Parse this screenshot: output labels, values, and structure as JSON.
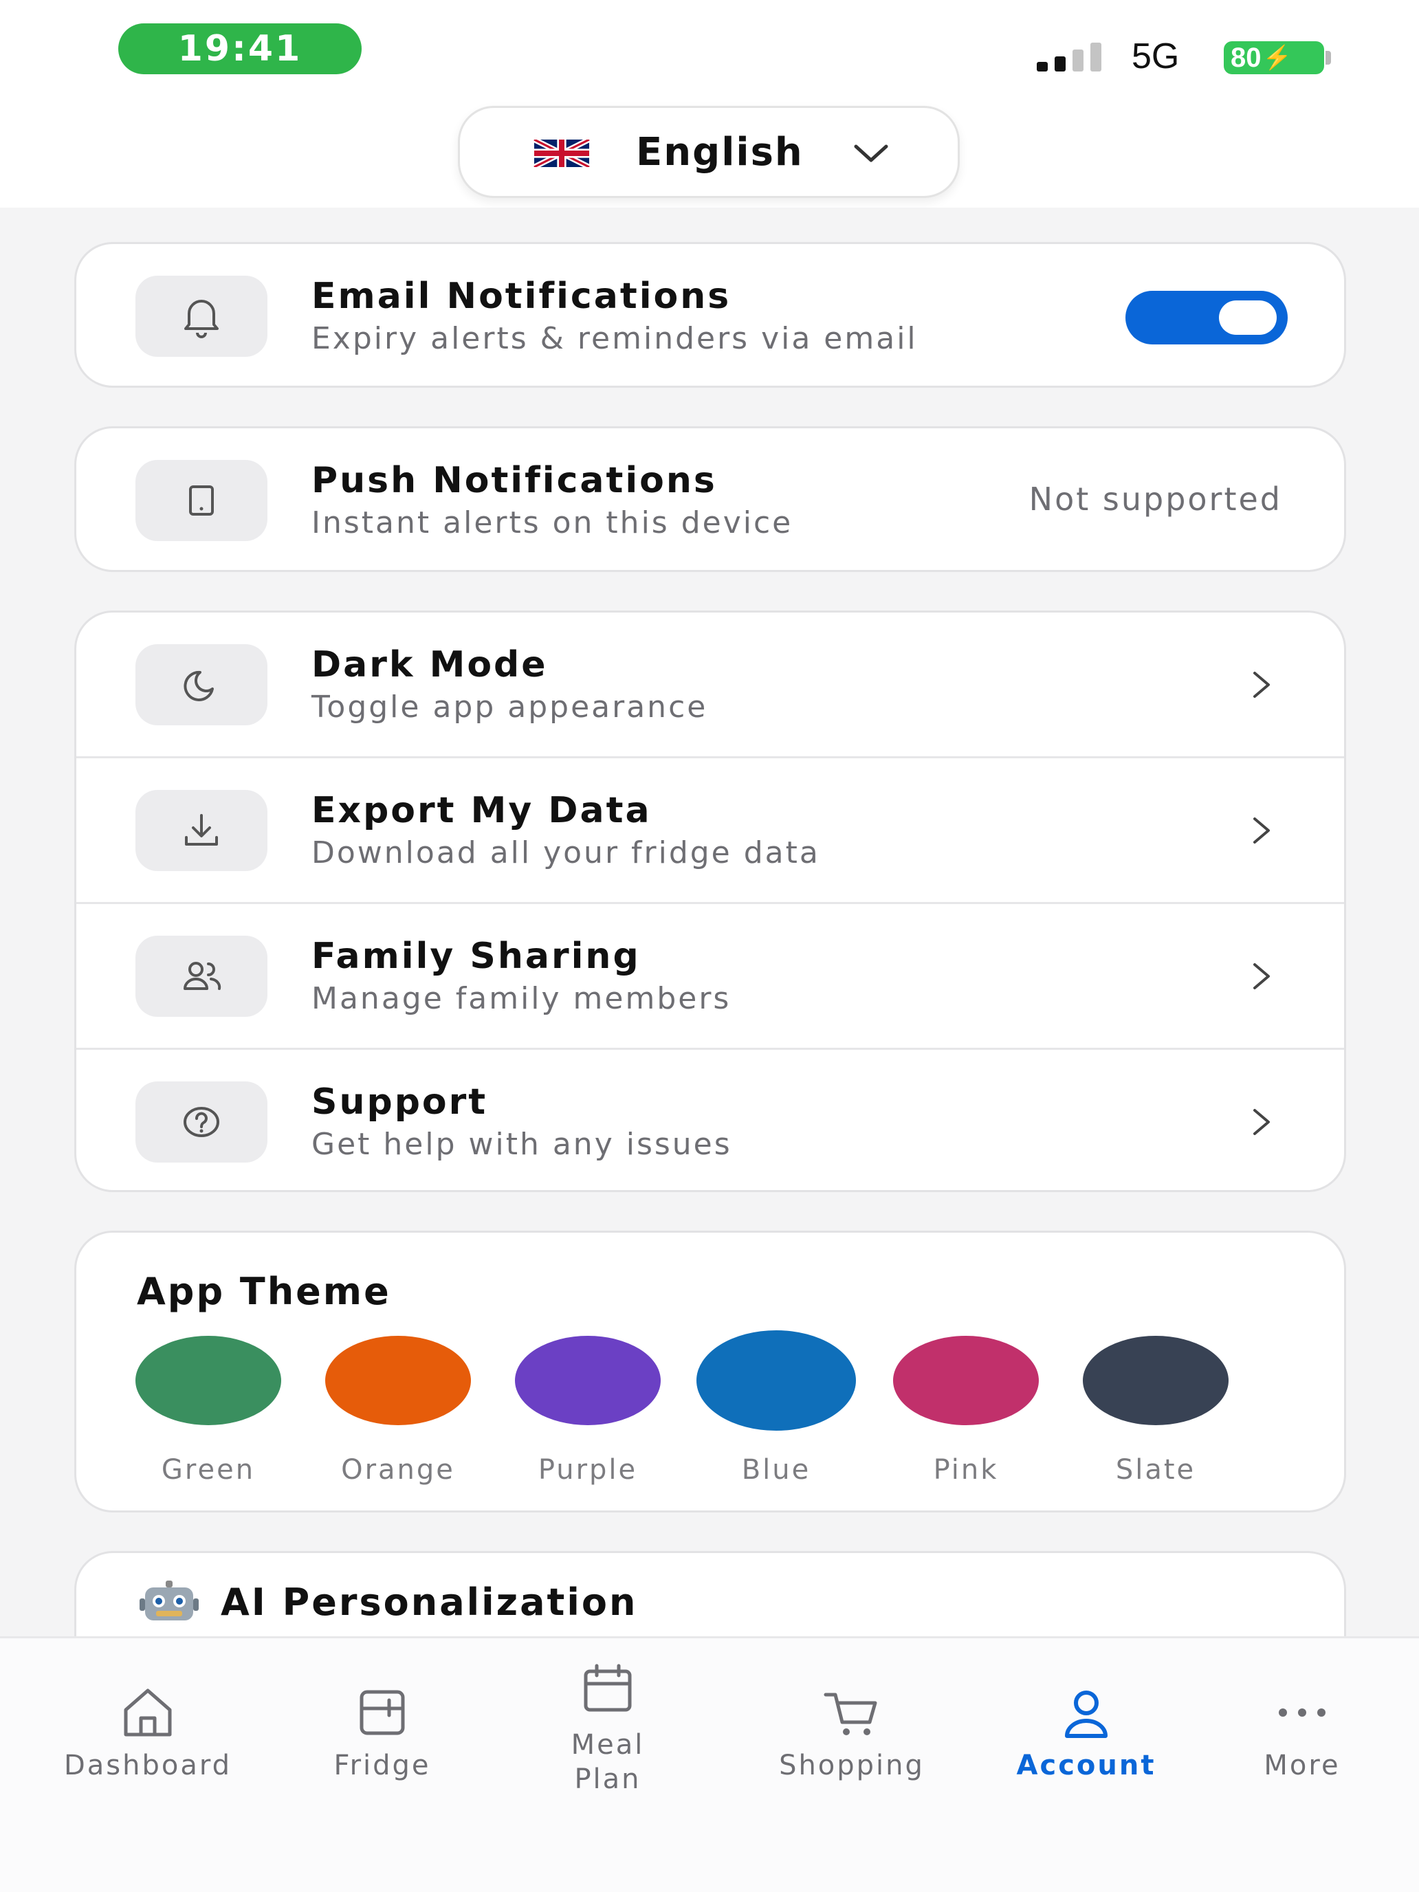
{
  "status_bar": {
    "time": "19:41",
    "network": "5G",
    "battery": "80"
  },
  "language": {
    "label": "English",
    "flag": "uk-flag-icon"
  },
  "notifications": {
    "email": {
      "title": "Email Notifications",
      "subtitle": "Expiry alerts & reminders via email",
      "enabled": true,
      "icon": "bell-icon"
    },
    "push": {
      "title": "Push Notifications",
      "subtitle": "Instant alerts on this device",
      "status": "Not supported",
      "icon": "tablet-icon"
    }
  },
  "settings": {
    "items": [
      {
        "title": "Dark Mode",
        "subtitle": "Toggle app appearance",
        "icon": "moon-icon"
      },
      {
        "title": "Export My Data",
        "subtitle": "Download all your fridge data",
        "icon": "download-icon"
      },
      {
        "title": "Family Sharing",
        "subtitle": "Manage family members",
        "icon": "users-icon"
      },
      {
        "title": "Support",
        "subtitle": "Get help with any issues",
        "icon": "help-circle-icon"
      }
    ]
  },
  "theme": {
    "title": "App Theme",
    "options": [
      {
        "label": "Green",
        "color": "#3a8f5f"
      },
      {
        "label": "Orange",
        "color": "#e65c0a"
      },
      {
        "label": "Purple",
        "color": "#6b40c4"
      },
      {
        "label": "Blue",
        "color": "#0f6fba"
      },
      {
        "label": "Pink",
        "color": "#c1306b"
      },
      {
        "label": "Slate",
        "color": "#384254"
      }
    ]
  },
  "ai": {
    "title": "AI Personalization",
    "icon": "robot-icon"
  },
  "tabs": [
    {
      "label": "Dashboard",
      "icon": "home-icon"
    },
    {
      "label": "Fridge",
      "icon": "fridge-icon"
    },
    {
      "label": "Meal\nPlan",
      "icon": "calendar-icon"
    },
    {
      "label": "Shopping",
      "icon": "cart-icon"
    },
    {
      "label": "Account",
      "icon": "user-icon",
      "active": true
    },
    {
      "label": "More",
      "icon": "more-dots-icon"
    }
  ],
  "colors": {
    "accent": "#0a66d8",
    "battery": "#34c759",
    "time_pill": "#2fb54a"
  }
}
